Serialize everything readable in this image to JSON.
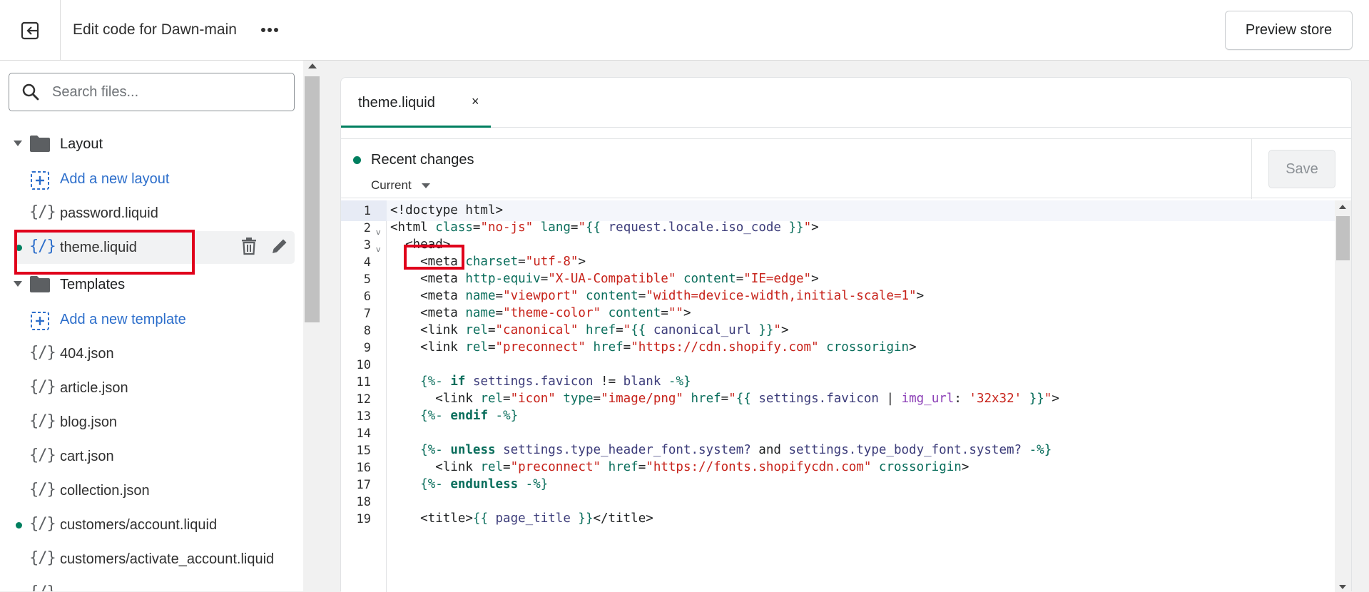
{
  "topbar": {
    "exit_icon": "exit-icon",
    "title": "Edit code for Dawn-main",
    "more_icon": "more-horizontal-icon",
    "preview_label": "Preview store"
  },
  "sidebar": {
    "search_placeholder": "Search files...",
    "layout_folder": "Layout",
    "add_layout": "Add a new layout",
    "layout_files": [
      "password.liquid",
      "theme.liquid"
    ],
    "templates_folder": "Templates",
    "add_template": "Add a new template",
    "template_files": [
      "404.json",
      "article.json",
      "blog.json",
      "cart.json",
      "collection.json",
      "customers/account.liquid",
      "customers/activate_account.liquid"
    ],
    "file_icon_glyph": "{/}",
    "modified_files": [
      "theme.liquid",
      "customers/account.liquid"
    ]
  },
  "editor": {
    "tab_label": "theme.liquid",
    "tab_close": "×",
    "recent_changes": "Recent changes",
    "version_select": "Current",
    "save_label": "Save",
    "line_numbers": [
      "1",
      "2",
      "3",
      "4",
      "5",
      "6",
      "7",
      "8",
      "9",
      "10",
      "11",
      "12",
      "13",
      "14",
      "15",
      "16",
      "17",
      "18",
      "19"
    ]
  },
  "colors": {
    "accent_green": "#007f5f",
    "link_blue": "#2c6ecb",
    "highlight_red": "#e0001b"
  }
}
